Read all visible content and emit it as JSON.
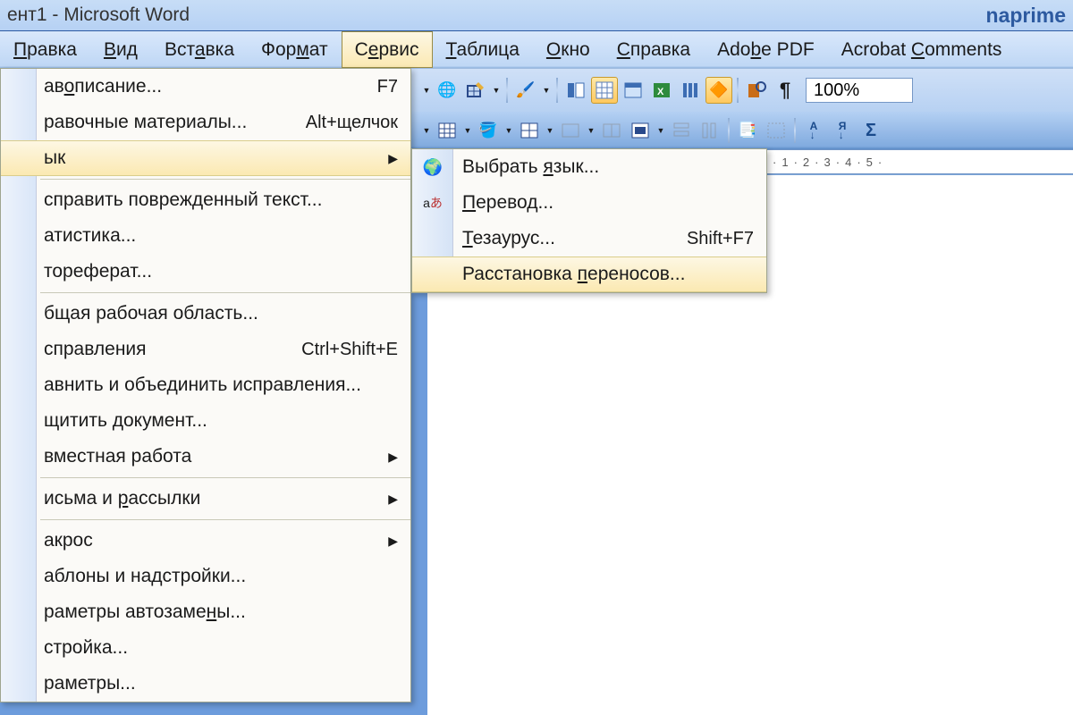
{
  "title_bar": {
    "title": "ент1 - Microsoft Word",
    "watermark": "naprime"
  },
  "menu": {
    "items": [
      {
        "label": "Правка",
        "ul": "П"
      },
      {
        "label": "Вид",
        "ul": "В"
      },
      {
        "label": "Вставка",
        "ul": "а"
      },
      {
        "label": "Формат",
        "ul": "м"
      },
      {
        "label": "Сервис",
        "ul": "е",
        "active": true
      },
      {
        "label": "Таблица",
        "ul": "Т"
      },
      {
        "label": "Окно",
        "ul": "О"
      },
      {
        "label": "Справка",
        "ul": "С"
      },
      {
        "label": "Adobe PDF",
        "ul": "b"
      },
      {
        "label": "Acrobat Comments",
        "ul": "C"
      }
    ]
  },
  "toolbar": {
    "zoom": "100%"
  },
  "ruler": {
    "marks": [
      "1",
      "2",
      "3",
      "4",
      "5"
    ]
  },
  "service_menu": {
    "items": [
      {
        "label": "авописание...",
        "shortcut": "F7"
      },
      {
        "label": "равочные материалы...",
        "shortcut": "Alt+щелчок"
      },
      {
        "label": "ык",
        "submenu": true,
        "selected": true
      },
      {
        "sep": true
      },
      {
        "label": "справить поврежденный текст..."
      },
      {
        "label": "атистика..."
      },
      {
        "label": "тореферат..."
      },
      {
        "sep": true
      },
      {
        "label": "бщая рабочая область..."
      },
      {
        "label": "справления",
        "shortcut": "Ctrl+Shift+E"
      },
      {
        "label": "авнить и объединить исправления..."
      },
      {
        "label": "щитить документ..."
      },
      {
        "label": "вместная работа",
        "submenu": true
      },
      {
        "sep": true
      },
      {
        "label": "исьма и рассылки",
        "submenu": true
      },
      {
        "sep": true
      },
      {
        "label": "акрос",
        "submenu": true
      },
      {
        "label": "аблоны и надстройки..."
      },
      {
        "label": "раметры автозамены..."
      },
      {
        "label": "стройка..."
      },
      {
        "label": "раметры..."
      }
    ]
  },
  "language_submenu": {
    "items": [
      {
        "label": "Выбрать язык...",
        "icon": "globe"
      },
      {
        "label": "Перевод...",
        "icon": "translate"
      },
      {
        "label": "Тезаурус...",
        "shortcut": "Shift+F7"
      },
      {
        "label": "Расстановка переносов...",
        "selected": true
      }
    ]
  }
}
